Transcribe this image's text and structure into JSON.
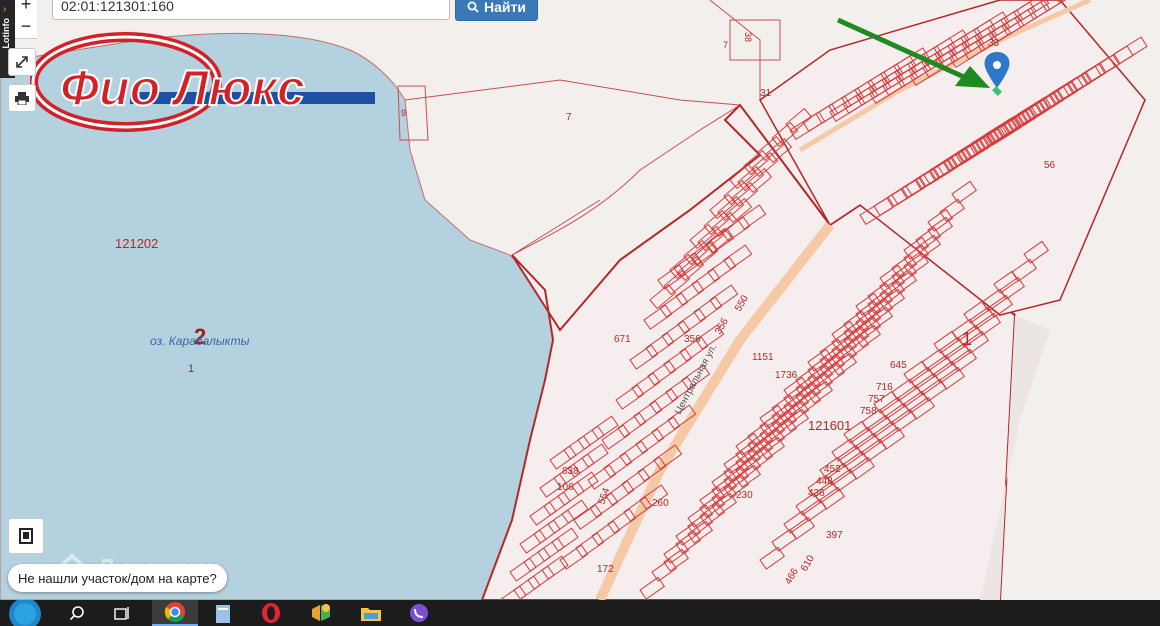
{
  "search": {
    "value": "02:01:121301:160",
    "button_label": "Найти"
  },
  "sidebar": {
    "label": "Lotinfo"
  },
  "zoom": {
    "in_label": "+",
    "out_label": "−"
  },
  "brand": {
    "logo_text": "Фио Люкс"
  },
  "map": {
    "lake": {
      "name": "оз. Карабалыкты"
    },
    "labels": {
      "quarter_121202": "121202",
      "quarter_121601": "121601",
      "parcel_2": "2",
      "parcel_1_lake": "1",
      "parcel_1_right": "1",
      "n9": "9",
      "n7_small": "7",
      "n7": "7",
      "n38": "38",
      "n31": "31",
      "n33": "33",
      "n56": "56",
      "n356a": "356",
      "n356b": "356",
      "n550": "550",
      "n671": "671",
      "n1151": "1151",
      "n1736": "1736",
      "n645": "645",
      "n716": "716",
      "n757": "757",
      "n758": "758",
      "n452": "452",
      "n448": "448",
      "n436": "436",
      "n230": "230",
      "n260": "260",
      "n838": "838",
      "n106": "106",
      "n554": "554",
      "n397": "397",
      "n610": "610",
      "n466": "466",
      "n172": "172",
      "street": "Центральная ул."
    }
  },
  "help": {
    "text": "Не нашли участок/дом на карте?"
  },
  "watermark": {
    "text": "Домклик"
  },
  "colors": {
    "water": "#b3d1df",
    "parcel": "#d83a3a",
    "boundary": "#b52727",
    "road": "#f5c9a6",
    "pin": "#2f77c9",
    "arrow": "#1f8a1f",
    "accent": "#3b78b8"
  },
  "taskbar": {
    "icons": [
      "start-icon",
      "search-icon",
      "task-view-icon",
      "chrome-icon",
      "app-icon",
      "opera-icon",
      "app2-icon",
      "folder-icon",
      "viber-icon"
    ]
  }
}
